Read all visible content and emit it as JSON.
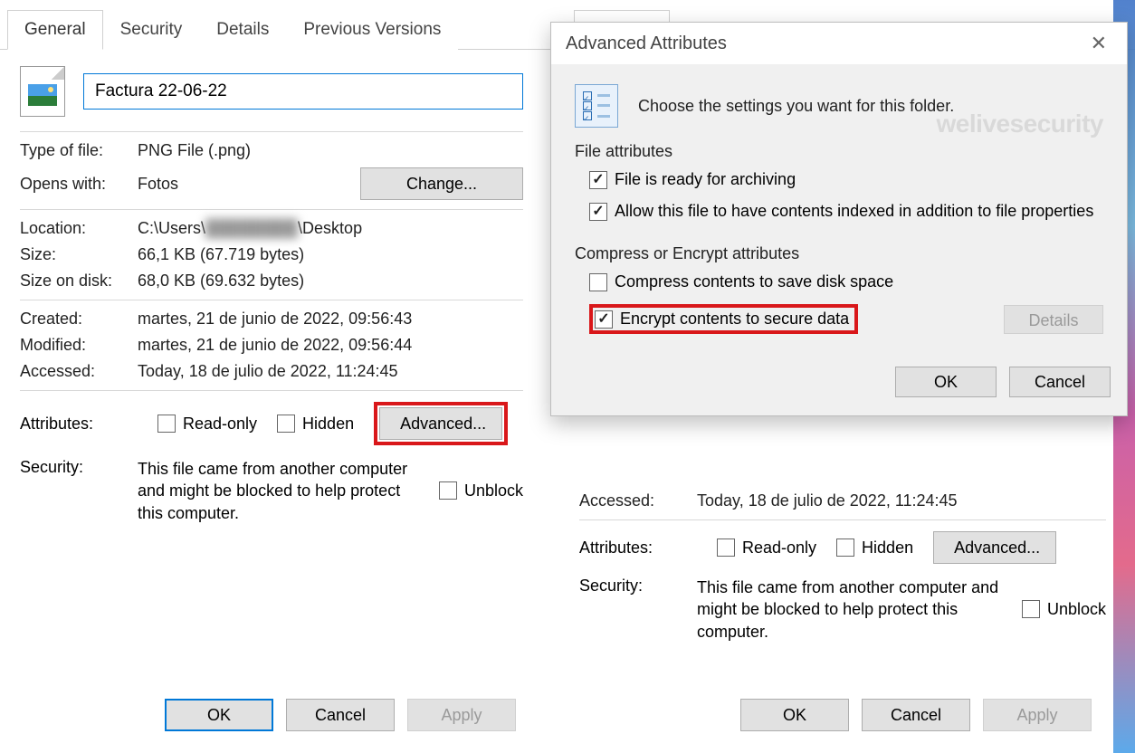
{
  "tabs": [
    "General",
    "Security",
    "Details",
    "Previous Versions"
  ],
  "filename": "Factura 22-06-22",
  "fields": {
    "type_label": "Type of file:",
    "type_value": "PNG File (.png)",
    "opens_label": "Opens with:",
    "opens_value": "Fotos",
    "change_btn": "Change...",
    "location_label": "Location:",
    "location_prefix": "C:\\Users\\",
    "location_redacted": "████████",
    "location_suffix": "\\Desktop",
    "size_label": "Size:",
    "size_value": "66,1 KB (67.719 bytes)",
    "disk_label": "Size on disk:",
    "disk_value": "68,0 KB (69.632 bytes)",
    "created_label": "Created:",
    "created_value": "martes, 21 de junio de 2022, 09:56:43",
    "modified_label": "Modified:",
    "modified_value": "martes, 21 de junio de 2022, 09:56:44",
    "accessed_label": "Accessed:",
    "accessed_value": "Today, 18 de julio de 2022, 11:24:45",
    "attributes_label": "Attributes:",
    "readonly_label": "Read-only",
    "hidden_label": "Hidden",
    "advanced_btn": "Advanced...",
    "security_label": "Security:",
    "security_msg": "This file came from another computer and might be blocked to help protect this computer.",
    "unblock_label": "Unblock"
  },
  "buttons": {
    "ok": "OK",
    "cancel": "Cancel",
    "apply": "Apply"
  },
  "adv": {
    "title": "Advanced Attributes",
    "choose": "Choose the settings you want for this folder.",
    "file_attr_title": "File attributes",
    "archive": "File is ready for archiving",
    "index": "Allow this file to have contents indexed in addition to file properties",
    "compress_title": "Compress or Encrypt attributes",
    "compress": "Compress contents to save disk space",
    "encrypt": "Encrypt contents to secure data",
    "details_btn": "Details"
  },
  "watermark": {
    "a": "we",
    "b": "live",
    "c": "security"
  }
}
